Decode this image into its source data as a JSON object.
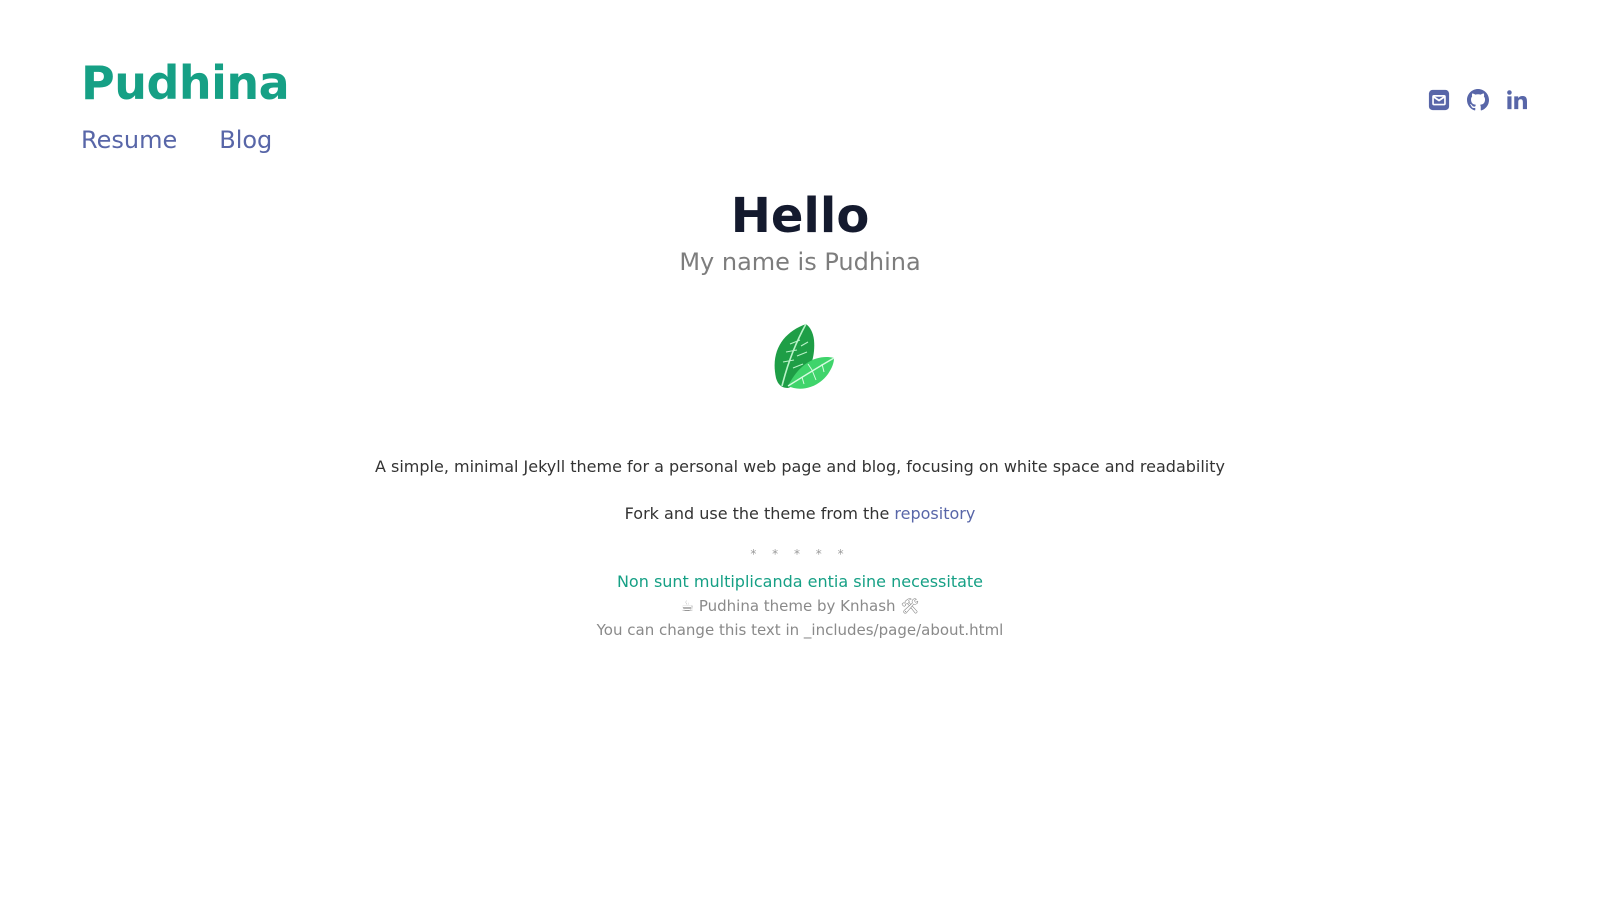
{
  "header": {
    "site_title": "Pudhina",
    "nav": [
      {
        "label": "Resume"
      },
      {
        "label": "Blog"
      }
    ],
    "social": [
      {
        "icon": "email-icon"
      },
      {
        "icon": "github-icon"
      },
      {
        "icon": "linkedin-icon"
      }
    ]
  },
  "main": {
    "heading": "Hello",
    "subtitle": "My name is Pudhina",
    "logo_icon": "mint-leaf-icon",
    "description": "A simple, minimal Jekyll theme for a personal web page and blog, focusing on white space and readability",
    "fork_text": "Fork and use the theme from the",
    "fork_link": "repository",
    "separator": "* * * * *",
    "motto": "Non sunt multiplicanda entia sine necessitate",
    "credit": "☕ Pudhina theme by Knhash 🛠",
    "change_note": "You can change this text in _includes/page/about.html"
  },
  "colors": {
    "accent": "#16a085",
    "link": "#5866a8",
    "heading": "#141a2e",
    "muted": "#8a8a8a",
    "leaf_dark": "#1e9e46",
    "leaf_light": "#3fd46b"
  }
}
